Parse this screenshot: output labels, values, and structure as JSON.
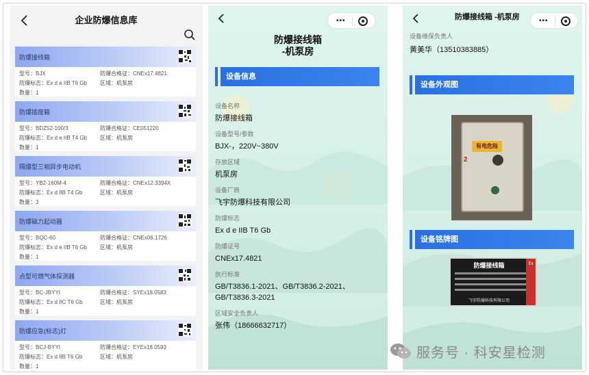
{
  "list_page": {
    "title": "企业防爆信息库",
    "cards": [
      {
        "name": "防爆接线箱",
        "c1": "型号：BJX",
        "c2": "防爆合格证：CNEx17.4821",
        "c3": "防爆标志：Ex d e IIB T6 Gb",
        "c4": "区域：机泵房",
        "c5": "数量：1"
      },
      {
        "name": "防爆插座箱",
        "c1": "型号：BDZ52-100/3",
        "c2": "防爆合格证：CE051220",
        "c3": "防爆标志：Ex d e IIB T4 Gb",
        "c4": "区域：机泵房",
        "c5": "数量：1"
      },
      {
        "name": "隔爆型三相异步电动机",
        "c1": "型号：YB2-160M-4",
        "c2": "防爆合格证：CNEx12.3394X",
        "c3": "防爆标志：Ex d IIB T4 Gb",
        "c4": "区域：机泵房",
        "c5": "数量：3"
      },
      {
        "name": "防爆磁力起动器",
        "c1": "型号：BQC-60",
        "c2": "防爆合格证：CNEx06.1726",
        "c3": "防爆标志：Ex d e IIB T6 Gb",
        "c4": "区域：机泵房",
        "c5": "数量：1"
      },
      {
        "name": "点型可燃气体探测器",
        "c1": "型号：BC-JBYYI",
        "c2": "防爆合格证：SYEx18.0583",
        "c3": "防爆标志：Ex d IIC T6 Gb",
        "c4": "区域：机泵房",
        "c5": "数量：1"
      },
      {
        "name": "防爆应急(标志)灯",
        "c1": "型号：BCJ-BYYI",
        "c2": "防爆合格证：EYEx18.0593",
        "c3": "防爆标志：Ex d IIB T6 Gb",
        "c4": "区域：机泵房",
        "c5": "数量：1"
      }
    ]
  },
  "detail_page": {
    "title_line1": "防爆接线箱",
    "title_line2": "-机泵房",
    "section": "设备信息",
    "fields": [
      {
        "label": "设备名称",
        "value": "防爆接线箱"
      },
      {
        "label": "设备型号/参数",
        "value": "BJX-，220V~380V"
      },
      {
        "label": "存放区域",
        "value": "机泵房"
      },
      {
        "label": "设备厂商",
        "value": "飞宇防爆科技有限公司"
      },
      {
        "label": "防爆标志",
        "value": " Ex d e IIB T6 Gb"
      },
      {
        "label": "防爆证号",
        "value": "CNEx17.4821"
      },
      {
        "label": "执行标准",
        "value": "GB/T3836.1-2021、GB/T3836.2-2021、GB/T3836.3-2021"
      },
      {
        "label": "区域安全负责人",
        "value": "张伟（18666632717）"
      }
    ]
  },
  "photo_page": {
    "title": "防爆接线箱 -机泵房",
    "person_label": "设备维保负责人",
    "person_value": "黄美华（13510383885）",
    "section_photo": "设备外观图",
    "section_plate": "设备铭牌图",
    "photo_warning": "有电危险",
    "photo_number": "2",
    "plate_title": "防爆接线箱",
    "plate_footer": "飞宇防爆科技有限公司",
    "plate_ex": "Ex"
  },
  "watermark": "服务号 · 科安星检测",
  "colors": {
    "accent_blue": "#2a6fe0",
    "card_gradient": "#8fa8f2",
    "mint": "#d5efe8"
  }
}
